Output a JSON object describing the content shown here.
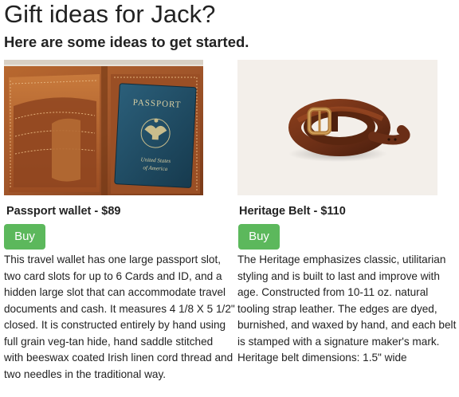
{
  "header": {
    "title": "Gift ideas for Jack?",
    "subtitle": "Here are some ideas to get started."
  },
  "products": [
    {
      "name": "Passport wallet - $89",
      "buy_label": "Buy",
      "description": "This travel wallet has one large passport slot, two card slots for up to 6 Cards and ID, and a hidden large slot that can accommodate travel documents and cash. It measures 4 1/8 X 5 1/2\" closed. It is constructed entirely by hand using full grain veg-tan hide, hand saddle stitched with beeswax coated Irish linen cord thread and two needles in the traditional way.",
      "image_text": {
        "passport_title": "PASSPORT",
        "passport_country_line1": "United States",
        "passport_country_line2": "of America"
      }
    },
    {
      "name": "Heritage Belt - $110",
      "buy_label": "Buy",
      "description": "The Heritage emphasizes classic, utilitarian styling and is built to last and improve with age. Constructed from 10-11 oz. natural tooling strap leather. The edges are dyed, burnished, and waxed by hand, and each belt is stamped with a signature maker's mark. Heritage belt dimensions: 1.5\" wide"
    }
  ],
  "colors": {
    "buy_button": "#5cb85c",
    "text": "#222222",
    "wallet_leather": "#a0552a",
    "passport_cover": "#1f4860",
    "belt_leather": "#6a2e16",
    "belt_background": "#f3efea"
  }
}
